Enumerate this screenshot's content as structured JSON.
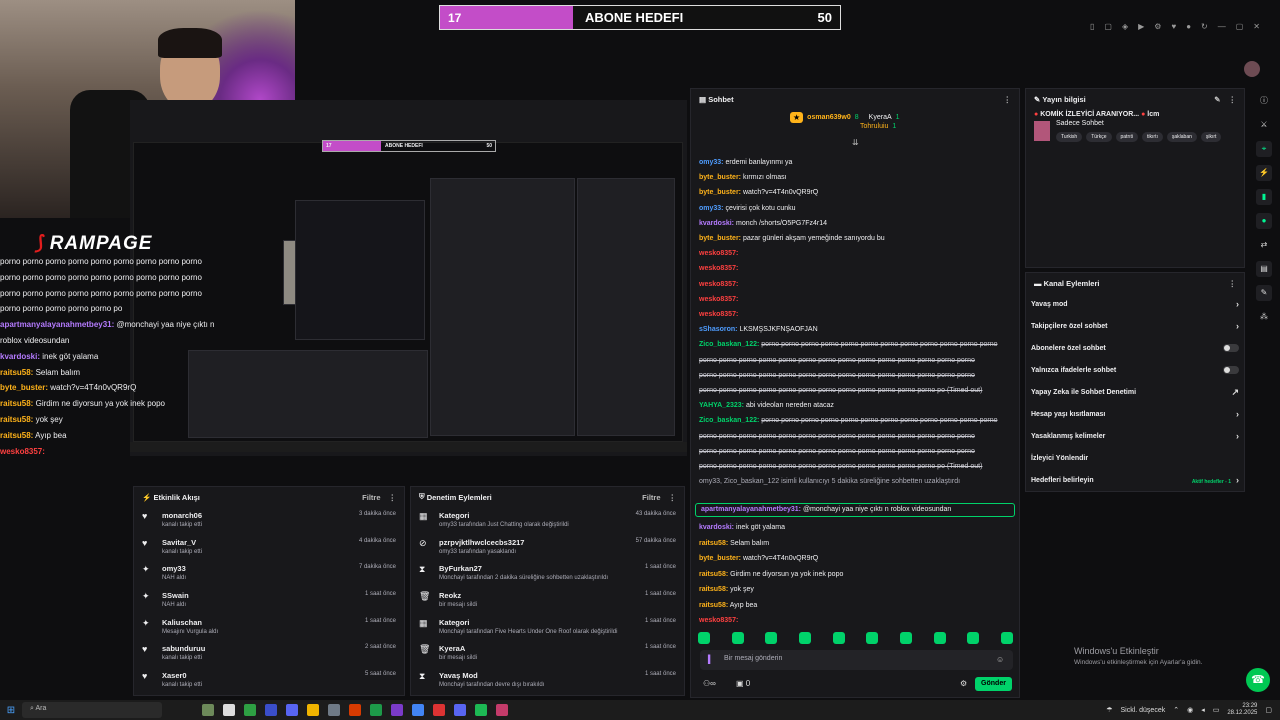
{
  "goal": {
    "current": "17",
    "title": "ABONE HEDEFI",
    "target": "50"
  },
  "overlay": {
    "brand": "RAMPAGE",
    "chat": [
      {
        "user": "",
        "text": "porno porno porno porno porno porno porno porno porno",
        "color": "#efeff1"
      },
      {
        "user": "",
        "text": "porno porno porno porno porno porno porno porno porno",
        "color": "#efeff1"
      },
      {
        "user": "",
        "text": "porno porno porno porno porno porno porno porno porno",
        "color": "#efeff1"
      },
      {
        "user": "",
        "text": "porno porno porno porno porno po",
        "color": "#efeff1"
      },
      {
        "user": "apartmanyalayanahmetbey31:",
        "text": "@monchayi yaa niye çıktı n",
        "color": "#b57bff"
      },
      {
        "user": "",
        "text": "roblox videosundan",
        "color": "#efeff1"
      },
      {
        "user": "kvardoski:",
        "text": "inek göt yalama",
        "color": "#b57bff"
      },
      {
        "user": "raitsu58:",
        "text": "Selam balım",
        "color": "#ffb31a"
      },
      {
        "user": "byte_buster:",
        "text": "watch?v=4T4n0vQR9rQ",
        "color": "#ffb31a"
      },
      {
        "user": "raitsu58:",
        "text": "Girdim ne diyorsun ya yok inek popo",
        "color": "#ffb31a"
      },
      {
        "user": "raitsu58:",
        "text": "yok şey",
        "color": "#ffb31a"
      },
      {
        "user": "raitsu58:",
        "text": "Ayıp bea",
        "color": "#ffb31a"
      },
      {
        "user": "wesko8357:",
        "text": "",
        "color": "#ff4040"
      }
    ]
  },
  "preview": {
    "goal_current": "17",
    "goal_title": "ABONE HEDEFI",
    "goal_target": "50"
  },
  "activity": {
    "title": "Etkinlik Akışı",
    "filter": "Filtre",
    "items": [
      {
        "icon": "heart-icon",
        "glyph": "♥",
        "name": "monarch06",
        "desc": "kanalı takip etti",
        "time": "3 dakika önce"
      },
      {
        "icon": "heart-icon",
        "glyph": "♥",
        "name": "Savitar_V",
        "desc": "kanalı takip etti",
        "time": "4 dakika önce"
      },
      {
        "icon": "kicks-icon",
        "glyph": "✦",
        "name": "omy33",
        "desc": "NAH aldı",
        "time": "7 dakika önce"
      },
      {
        "icon": "kicks-icon",
        "glyph": "✦",
        "name": "SSwain",
        "desc": "NAH aldı",
        "time": "1 saat önce"
      },
      {
        "icon": "kicks-icon",
        "glyph": "✦",
        "name": "Kaliuschan",
        "desc": "Mesajını Vurgula aldı",
        "time": "1 saat önce"
      },
      {
        "icon": "heart-icon",
        "glyph": "♥",
        "name": "sabunduruu",
        "desc": "kanalı takip etti",
        "time": "2 saat önce"
      },
      {
        "icon": "heart-icon",
        "glyph": "♥",
        "name": "Xaser0",
        "desc": "kanalı takip etti",
        "time": "5 saat önce"
      }
    ]
  },
  "modlog": {
    "title": "Denetim Eylemleri",
    "filter": "Filtre",
    "items": [
      {
        "icon": "category-icon",
        "glyph": "▦",
        "name": "Kategori",
        "desc": "omy33 tarafından Just Chatting olarak değiştirildi",
        "time": "43 dakika önce"
      },
      {
        "icon": "ban-icon",
        "glyph": "⊘",
        "name": "pzrpvjktlhwclcecbs3217",
        "desc": "omy33 tarafından yasaklandı",
        "time": "57 dakika önce"
      },
      {
        "icon": "timeout-icon",
        "glyph": "⧗",
        "name": "ByFurkan27",
        "desc": "Monchayi tarafından 2 dakika süreliğine sohbetten uzaklaştırıldı",
        "time": "1 saat önce"
      },
      {
        "icon": "delete-icon",
        "glyph": "🗑",
        "name": "Reokz",
        "desc": "bir mesajı sildi",
        "time": "1 saat önce"
      },
      {
        "icon": "category-icon",
        "glyph": "▦",
        "name": "Kategori",
        "desc": "Monchayi tarafından Five Hearts Under One Roof olarak değiştirildi",
        "time": "1 saat önce"
      },
      {
        "icon": "delete-icon",
        "glyph": "🗑",
        "name": "KyeraA",
        "desc": "bir mesajı sildi",
        "time": "1 saat önce"
      },
      {
        "icon": "slow-icon",
        "glyph": "⧗",
        "name": "Yavaş Mod",
        "desc": "Monchayi tarafından devre dışı bırakıldı",
        "time": "1 saat önce"
      }
    ]
  },
  "chat": {
    "title": "Sohbet",
    "top_user1": "osman639w0",
    "top_user1_count": "8",
    "top_user2": "KyeraA",
    "top_user2_count": "1",
    "top_user3": "Tohruluiu",
    "top_user3_count": "1",
    "messages": [
      {
        "user": "omy33:",
        "cls": "u-blue",
        "text": "erdemi banlayınmı ya"
      },
      {
        "user": "byte_buster:",
        "cls": "u-yellow",
        "text": "kırmızı olması"
      },
      {
        "user": "byte_buster:",
        "cls": "u-yellow",
        "text": "watch?v=4T4n0vQR9rQ"
      },
      {
        "user": "omy33:",
        "cls": "u-blue",
        "text": "çevirisi çok kotu cunku"
      },
      {
        "user": "kvardoski:",
        "cls": "u-purple",
        "text": "monch /shorts/O5PG7Fz4r14"
      },
      {
        "user": "byte_buster:",
        "cls": "u-yellow",
        "text": "pazar günleri akşam yemeğinde sanıyordu bu"
      },
      {
        "user": "wesko8357:",
        "cls": "u-red",
        "text": "",
        "strike": true
      },
      {
        "user": "wesko8357:",
        "cls": "u-red",
        "text": "",
        "strike": true
      },
      {
        "user": "wesko8357:",
        "cls": "u-red",
        "text": "",
        "strike": true
      },
      {
        "user": "wesko8357:",
        "cls": "u-red",
        "text": "",
        "strike": true
      },
      {
        "user": "wesko8357:",
        "cls": "u-red",
        "text": "",
        "strike": true
      },
      {
        "user": "sShasoron:",
        "cls": "u-blue",
        "text": "LKSMŞSJKFNŞAOFJAN"
      },
      {
        "user": "Zico_baskan_122:",
        "cls": "u-green",
        "text": "porno porno porno porno porno porno porno porno porno porno porno porno",
        "strike": true
      },
      {
        "user": "",
        "cls": "",
        "text": "porno porno porno porno porno porno porno porno porno porno porno porno porno porno",
        "strike": true
      },
      {
        "user": "",
        "cls": "",
        "text": "porno porno porno porno porno porno porno porno porno porno porno porno porno porno",
        "strike": true
      },
      {
        "user": "",
        "cls": "",
        "text": "porno porno porno porno porno porno porno porno porno porno porno porno po (Timed out)",
        "strike": true
      },
      {
        "user": "YAHYA_2323:",
        "cls": "u-green",
        "text": "abi videoları nereden atacaz"
      },
      {
        "user": "Zico_baskan_122:",
        "cls": "u-green",
        "text": "porno porno porno porno porno porno porno porno porno porno porno porno",
        "strike": true
      },
      {
        "user": "",
        "cls": "",
        "text": "porno porno porno porno porno porno porno porno porno porno porno porno porno porno",
        "strike": true
      },
      {
        "user": "",
        "cls": "",
        "text": "porno porno porno porno porno porno porno porno porno porno porno porno porno porno",
        "strike": true
      },
      {
        "user": "",
        "cls": "",
        "text": "porno porno porno porno porno porno porno porno porno porno porno porno po (Timed out)",
        "strike": true
      },
      {
        "user": "",
        "cls": "sys",
        "text": "omy33, Zico_baskan_122 isimli kullanıcıyı 5 dakika süreliğine sohbetten uzaklaştırdı"
      }
    ],
    "highlight": {
      "user": "apartmanyalayanahmetbey31:",
      "text": "@monchayi yaa niye çıktı n roblox videosundan"
    },
    "after": [
      {
        "user": "kvardoski:",
        "cls": "u-purple",
        "text": "inek göt yalama"
      },
      {
        "user": "raitsu58:",
        "cls": "u-yellow",
        "text": "Selam balım"
      },
      {
        "user": "byte_buster:",
        "cls": "u-yellow",
        "text": "watch?v=4T4n0vQR9rQ"
      },
      {
        "user": "raitsu58:",
        "cls": "u-yellow",
        "text": "Girdim ne diyorsun ya yok inek popo"
      },
      {
        "user": "raitsu58:",
        "cls": "u-yellow",
        "text": "yok şey"
      },
      {
        "user": "raitsu58:",
        "cls": "u-yellow",
        "text": "Ayıp bea"
      },
      {
        "user": "wesko8357:",
        "cls": "u-red",
        "text": ""
      }
    ],
    "input_placeholder": "Bir mesaj gönderin",
    "send_label": "Gönder",
    "points": "0"
  },
  "stream_info": {
    "title": "Yayın bilgisi",
    "stream_title": "KOMİK İZLEYİCİ ARANIYOR...",
    "stream_title_extra": "lcm",
    "category": "Sadece Sohbet",
    "tags": [
      "Turkish",
      "Türkçe",
      "patrıti",
      "tikırtı",
      "şaklaban",
      "şikırt"
    ]
  },
  "mod_actions": {
    "title": "Kanal Eylemleri",
    "items": [
      {
        "label": "Yavaş mod",
        "type": "arrow"
      },
      {
        "label": "Takipçilere özel sohbet",
        "type": "arrow"
      },
      {
        "label": "Abonelere özel sohbet",
        "type": "toggle"
      },
      {
        "label": "Yalnızca ifadelerle sohbet",
        "type": "toggle"
      },
      {
        "label": "Yapay Zeka ile Sohbet Denetimi",
        "type": "link"
      },
      {
        "label": "Hesap yaşı kısıtlaması",
        "type": "arrow"
      },
      {
        "label": "Yasaklanmış kelimeler",
        "type": "arrow"
      },
      {
        "label": "İzleyici Yönlendir",
        "type": "none"
      },
      {
        "label": "Hedefleri belirleyin",
        "type": "arrow",
        "extra": "Aktif hedefler - 1"
      }
    ]
  },
  "windows": {
    "line1": "Windows'u Etkinleştir",
    "line2": "Windows'u etkinleştirmek için Ayarlar'a gidin."
  },
  "taskbar": {
    "search": "Ara",
    "weather": "Sickl. düşecek",
    "time": "23:29",
    "date": "28.12.2025"
  }
}
